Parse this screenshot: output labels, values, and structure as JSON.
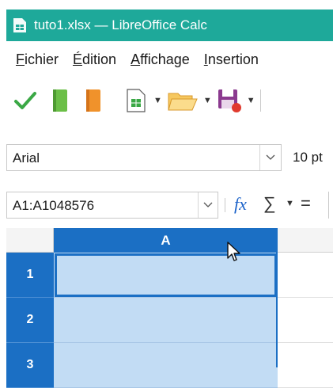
{
  "window": {
    "title": "tuto1.xlsx — LibreOffice Calc",
    "accent_color": "#1ea99a"
  },
  "menubar": {
    "items": [
      {
        "label": "Fichier",
        "mnemonic": "F"
      },
      {
        "label": "Édition",
        "mnemonic": "É"
      },
      {
        "label": "Affichage",
        "mnemonic": "A"
      },
      {
        "label": "Insertion",
        "mnemonic": "I"
      }
    ]
  },
  "toolbar": {
    "icons": [
      "check-icon",
      "green-book-icon",
      "orange-book-icon",
      "new-spreadsheet-icon",
      "open-folder-icon",
      "save-icon"
    ]
  },
  "fontbar": {
    "font_name": "Arial",
    "font_size": "10 pt"
  },
  "formulabar": {
    "name_box": "A1:A1048576",
    "fx": "fx",
    "sigma": "∑",
    "equals": "="
  },
  "grid": {
    "columns": [
      "A"
    ],
    "rows": [
      "1",
      "2",
      "3"
    ],
    "selection_color": "#1b6fc4",
    "selection_fill": "#c2dcf4"
  }
}
